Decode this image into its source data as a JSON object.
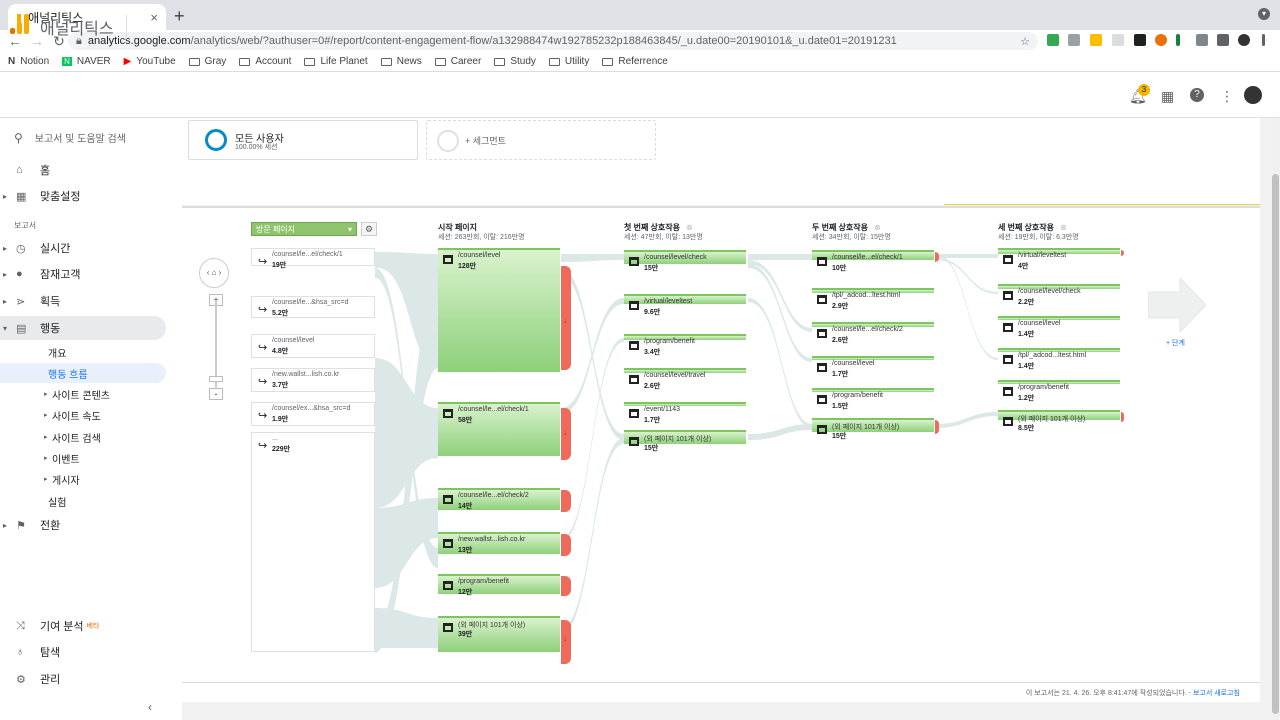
{
  "browser": {
    "tab_title": "애널리틱스",
    "url_host": "analytics.google.com",
    "url_path": "/analytics/web/?authuser=0#/report/content-engagement-flow/a132988474w192785232p188463845/_u.date00=20190101&_u.date01=20191231",
    "bookmarks": [
      "Notion",
      "NAVER",
      "YouTube",
      "Gray",
      "Account",
      "Life Planet",
      "News",
      "Career",
      "Study",
      "Utility",
      "Referrence"
    ],
    "notification_count": "3"
  },
  "header": {
    "title": "애널리틱스"
  },
  "sidebar": {
    "search_placeholder": "보고서 및 도움말 검색",
    "home": "홈",
    "custom": "맞춤설정",
    "section_label": "보고서",
    "realtime": "실시간",
    "audience": "잠재고객",
    "acquisition": "획득",
    "behavior": "행동",
    "behavior_sub": [
      "개요",
      "행동 흐름",
      "사이트 콘텐츠",
      "사이트 속도",
      "사이트 검색",
      "이벤트",
      "게시자",
      "실험"
    ],
    "conversions": "전환",
    "attribution": "기여 분석",
    "beta": "베타",
    "discover": "탐색",
    "admin": "관리"
  },
  "segments": {
    "active_name": "모든 사용자",
    "active_pct": "100.00% 세션",
    "add_label": "+ 세그먼트"
  },
  "flow": {
    "dimension_label": "방문 페이지",
    "columns": [
      {
        "title": "시작 페이지",
        "sub": "세션: 263만회, 이탈: 216만명"
      },
      {
        "title": "첫 번째 상호작용",
        "sub": "세션: 47만회, 이탈: 13만명"
      },
      {
        "title": "두 번째 상호작용",
        "sub": "세션: 34만회, 이탈: 15만명"
      },
      {
        "title": "세 번째 상호작용",
        "sub": "세션: 19만회, 이탈: 6.3만명"
      }
    ],
    "landing": [
      {
        "label": "/counsel/le...el/check/1",
        "value": "19만"
      },
      {
        "label": "/counsel/le...&hsa_src=d",
        "value": "5.2만"
      },
      {
        "label": "/counsel/level",
        "value": "4.8만"
      },
      {
        "label": "/new.wallst...lish.co.kr",
        "value": "3.7만"
      },
      {
        "label": "/counsel/ex...&hsa_src=d",
        "value": "1.9만"
      },
      {
        "label": "...",
        "value": "229만"
      }
    ],
    "start": [
      {
        "label": "/counsel/level",
        "value": "128만"
      },
      {
        "label": "/counsel/le...el/check/1",
        "value": "58만"
      },
      {
        "label": "/counsel/le...el/check/2",
        "value": "14만"
      },
      {
        "label": "/new.wallst...lish.co.kr",
        "value": "13만"
      },
      {
        "label": "/program/benefit",
        "value": "12만"
      },
      {
        "label": "(외 페이지 101개 이상)",
        "value": "39만"
      }
    ],
    "first": [
      {
        "label": "/counsel/level/check",
        "value": "15만"
      },
      {
        "label": "/virtual/leveltest",
        "value": "9.6만"
      },
      {
        "label": "/program/benefit",
        "value": "3.4만"
      },
      {
        "label": "/counsel/level/travel",
        "value": "2.6만"
      },
      {
        "label": "/event/1143",
        "value": "1.7만"
      },
      {
        "label": "(외 페이지 101개 이상)",
        "value": "15만"
      }
    ],
    "second": [
      {
        "label": "/counsel/le...el/check/1",
        "value": "10만"
      },
      {
        "label": "/tpl/_adcod...ltest.html",
        "value": "2.9만"
      },
      {
        "label": "/counsel/le...el/check/2",
        "value": "2.6만"
      },
      {
        "label": "/counsel/level",
        "value": "1.7만"
      },
      {
        "label": "/program/benefit",
        "value": "1.5만"
      },
      {
        "label": "(외 페이지 101개 이상)",
        "value": "15만"
      }
    ],
    "third": [
      {
        "label": "/virtual/leveltest",
        "value": "4만"
      },
      {
        "label": "/counsel/level/check",
        "value": "2.2만"
      },
      {
        "label": "/counsel/level",
        "value": "1.4만"
      },
      {
        "label": "/tpl/_adcod...ltest.html",
        "value": "1.4만"
      },
      {
        "label": "/program/benefit",
        "value": "1.2만"
      },
      {
        "label": "(외 페이지 101개 이상)",
        "value": "8.5만"
      }
    ],
    "next_step": "+ 단계"
  },
  "footer": {
    "text": "이 보고서는 21. 4. 26. 오후 8:41:47에 작성되었습니다. - ",
    "refresh": "보고서 새로고침"
  },
  "colors": {
    "accent": "#1a73e8",
    "node_green": "#8ed07a",
    "drop_red": "#ef6a5a",
    "link": "#d7e4e4"
  }
}
